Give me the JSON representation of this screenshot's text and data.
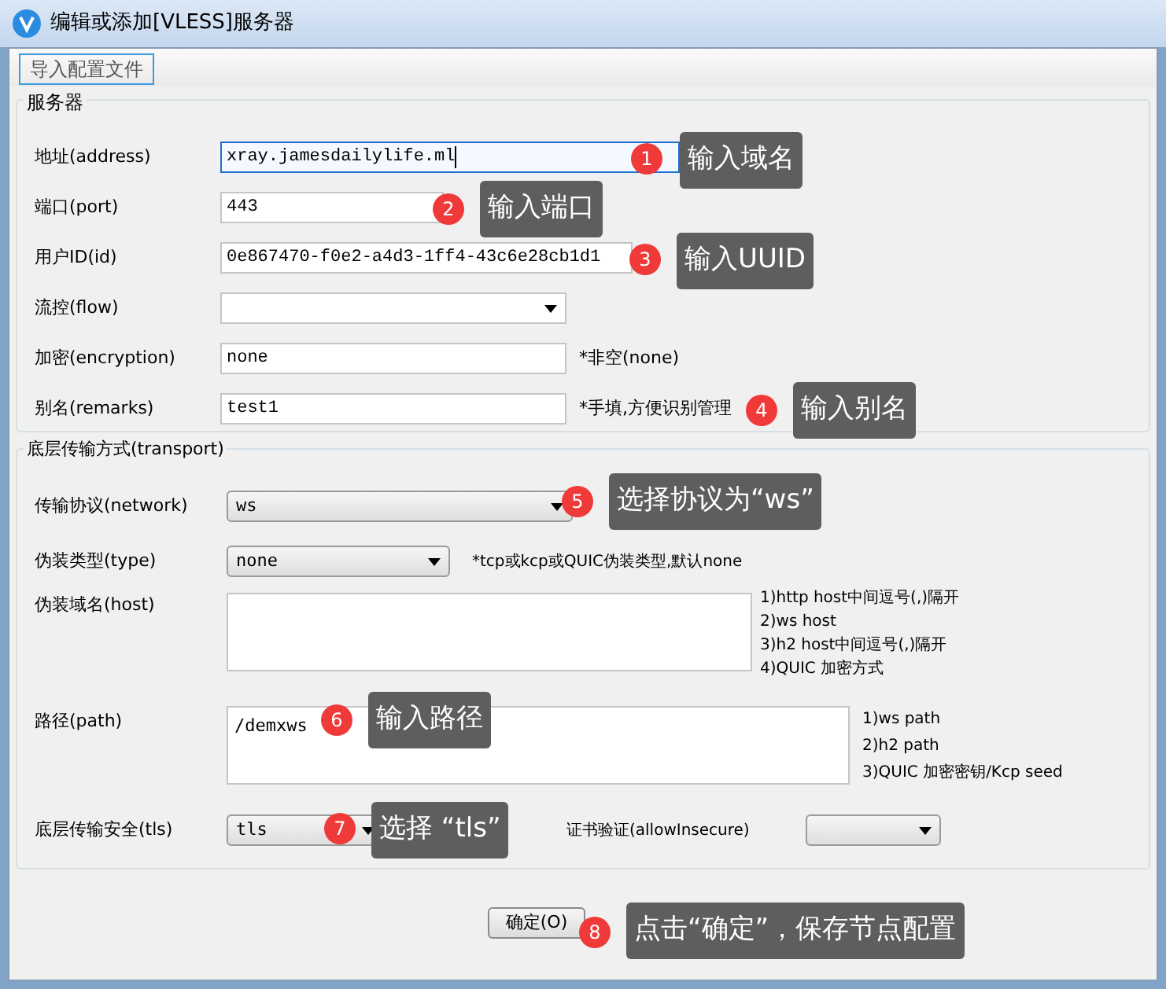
{
  "window": {
    "title": "编辑或添加[VLESS]服务器"
  },
  "toolbar": {
    "button": "导入配置文件"
  },
  "server": {
    "title": "服务器",
    "fields": [
      {
        "kind": "text",
        "label": "地址(address)",
        "value": "xray.jamesdailylife.ml",
        "focused": true
      },
      {
        "kind": "text",
        "label": "端口(port)",
        "value": "443"
      },
      {
        "kind": "text",
        "label": "用户ID(id)",
        "value": "0e867470-f0e2-a4d3-1ff4-43c6e28cb1d1"
      },
      {
        "kind": "select",
        "label": "流控(flow)"
      },
      {
        "kind": "text",
        "label": "加密(encryption)",
        "value": "none",
        "hint": "*非空(none)"
      },
      {
        "kind": "text",
        "label": "别名(remarks)",
        "value": "test1",
        "hint": "*手填,方便识别管理"
      }
    ]
  },
  "transport": {
    "title": "底层传输方式(transport)",
    "network": {
      "label": "传输协议(network)",
      "value": "ws"
    },
    "type": {
      "label": "伪装类型(type)",
      "value": "none",
      "hint": "*tcp或kcp或QUIC伪装类型,默认none"
    },
    "host": {
      "label": "伪装域名(host)",
      "notes": [
        "1)http host中间逗号(,)隔开",
        "2)ws host",
        "3)h2 host中间逗号(,)隔开",
        "4)QUIC 加密方式"
      ]
    },
    "path": {
      "label": "路径(path)",
      "value": "/demxws",
      "notes": [
        "1)ws path",
        "2)h2 path",
        "3)QUIC 加密密钥/Kcp seed"
      ]
    },
    "tls": {
      "label": "底层传输安全(tls)",
      "value": "tls",
      "hint": "证书验证(allowInsecure)"
    }
  },
  "footer": {
    "ok_button": "确定(O)"
  },
  "callouts": [
    {
      "number": "1",
      "text": "输入域名"
    },
    {
      "number": "2",
      "text": "输入端口"
    },
    {
      "number": "3",
      "text": "输入UUID"
    },
    {
      "number": "4",
      "text": "输入别名"
    },
    {
      "number": "5",
      "text": "选择协议为“ws”"
    },
    {
      "number": "6",
      "text": "输入路径"
    },
    {
      "number": "7",
      "text": "选择 “tls”"
    },
    {
      "number": "8",
      "text": "点击“确定”，保存节点配置"
    }
  ]
}
